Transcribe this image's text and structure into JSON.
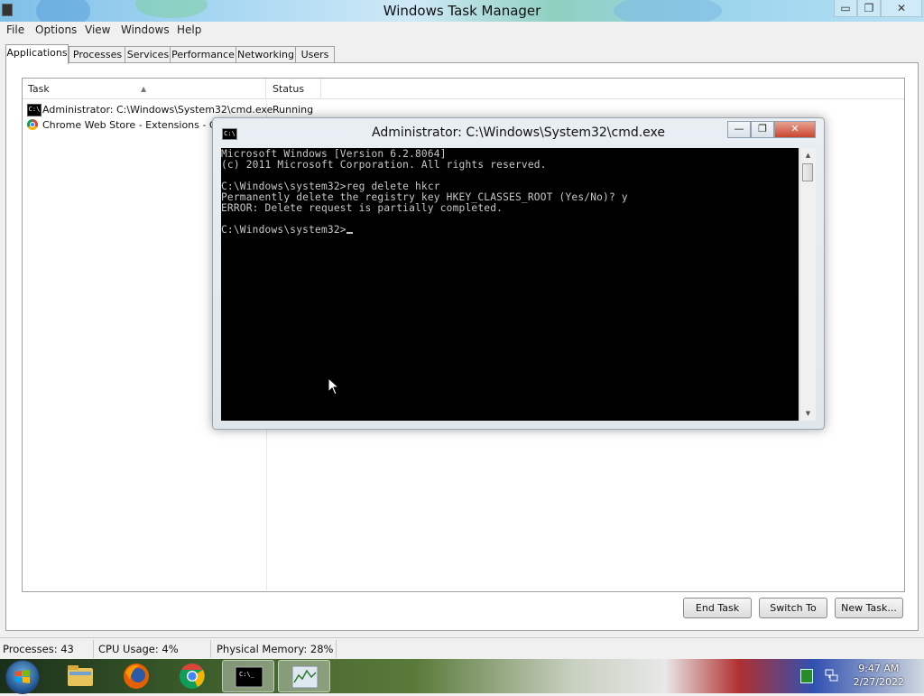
{
  "task_manager": {
    "title": "Windows Task Manager",
    "window_buttons": {
      "minimize": "▭",
      "restore": "❐",
      "close": "✕"
    },
    "menu": [
      "File",
      "Options",
      "View",
      "Windows",
      "Help"
    ],
    "tabs": [
      "Applications",
      "Processes",
      "Services",
      "Performance",
      "Networking",
      "Users"
    ],
    "active_tab": "Applications",
    "columns": {
      "task": "Task",
      "status": "Status"
    },
    "rows": [
      {
        "icon": "cmd-icon",
        "task": "Administrator: C:\\Windows\\System32\\cmd.exe",
        "status": "Running"
      },
      {
        "icon": "chrome-icon",
        "task": "Chrome Web Store - Extensions - Goog",
        "status": ""
      }
    ],
    "buttons": {
      "end_task": "End Task",
      "switch_to": "Switch To",
      "new_task": "New Task..."
    },
    "status_bar": {
      "processes": "Processes: 43",
      "cpu": "CPU Usage: 4%",
      "memory": "Physical Memory: 28%"
    }
  },
  "cmd_window": {
    "title": "Administrator: C:\\Windows\\System32\\cmd.exe",
    "icon_label": "C:\\",
    "window_buttons": {
      "minimize": "—",
      "restore": "❐",
      "close": "✕"
    },
    "console_lines": [
      "Microsoft Windows [Version 6.2.8064]",
      "(c) 2011 Microsoft Corporation. All rights reserved.",
      "",
      "C:\\Windows\\system32>reg delete hkcr",
      "Permanently delete the registry key HKEY_CLASSES_ROOT (Yes/No)? y",
      "ERROR: Delete request is partially completed.",
      "",
      "C:\\Windows\\system32>"
    ]
  },
  "taskbar": {
    "pinned": [
      "windows-explorer",
      "firefox",
      "chrome",
      "command-prompt",
      "task-manager"
    ],
    "clock_time": "9:47 AM",
    "clock_date": "2/27/2022"
  },
  "colors": {
    "console_bg": "#000000",
    "console_fg": "#c8c8c8",
    "window_chrome": "#dfe6ec"
  }
}
